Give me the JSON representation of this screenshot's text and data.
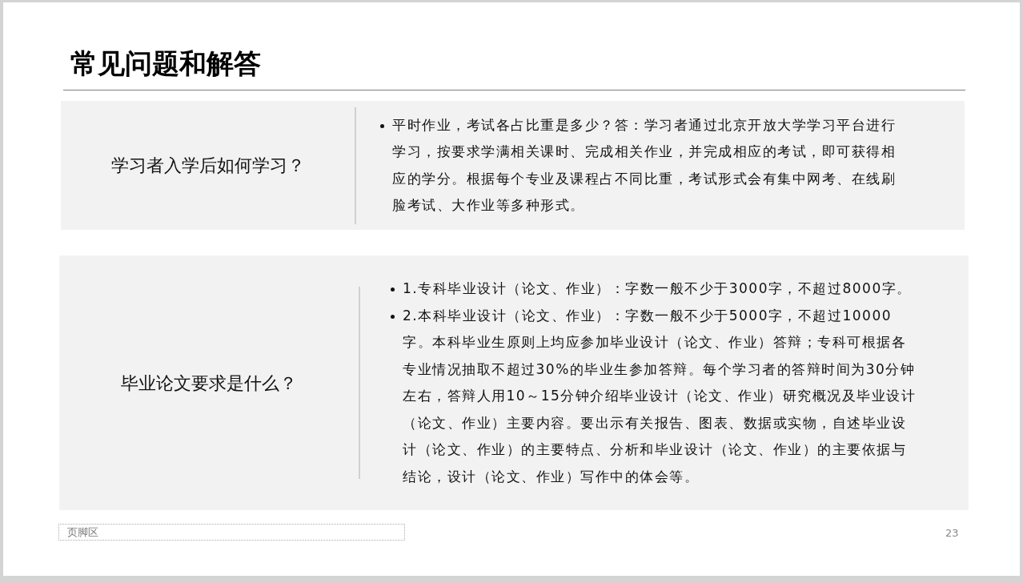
{
  "slide": {
    "title": "常见问题和解答",
    "faq": [
      {
        "question": "学习者入学后如何学习？",
        "answers": [
          "平时作业，考试各占比重是多少？答：学习者通过北京开放大学学习平台进行学习，按要求学满相关课时、完成相关作业，并完成相应的考试，即可获得相应的学分。根据每个专业及课程占不同比重，考试形式会有集中网考、在线刷脸考试、大作业等多种形式。"
        ]
      },
      {
        "question": "毕业论文要求是什么？",
        "answers": [
          "1.专科毕业设计（论文、作业）：字数一般不少于3000字，不超过8000字。",
          "2.本科毕业设计（论文、作业）：字数一般不少于5000字，不超过10000字。本科毕业生原则上均应参加毕业设计（论文、作业）答辩；专科可根据各专业情况抽取不超过30%的毕业生参加答辩。每个学习者的答辩时间为30分钟左右，答辩人用10～15分钟介绍毕业设计（论文、作业）研究概况及毕业设计（论文、作业）主要内容。要出示有关报告、图表、数据或实物，自述毕业设计（论文、作业）的主要特点、分析和毕业设计（论文、作业）的主要依据与结论，设计（论文、作业）写作中的体会等。"
        ]
      }
    ],
    "footer": {
      "placeholder": "页脚区",
      "page_number": "23"
    }
  }
}
